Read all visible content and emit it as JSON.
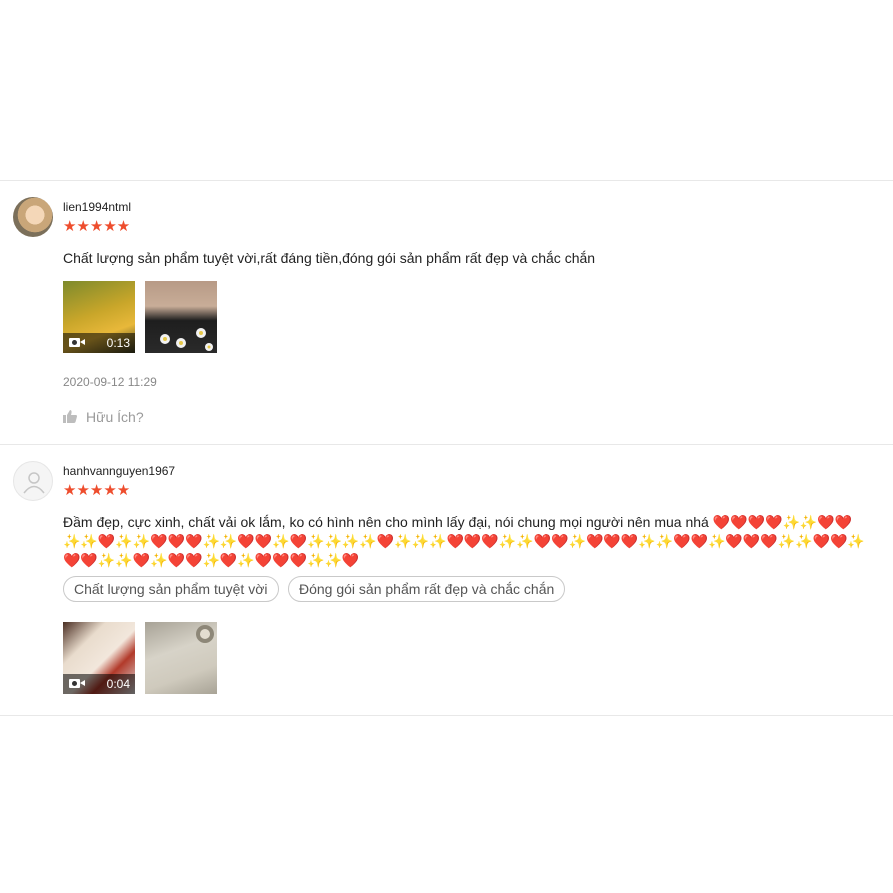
{
  "reviews": [
    {
      "username": "lien1994ntml",
      "stars": "★★★★★",
      "comment": "Chất lượng sản phẩm tuyệt vời,rất đáng tiền,đóng gói sản phẩm rất đẹp và chắc chắn",
      "video_duration": "0:13",
      "date": "2020-09-12 11:29",
      "helpful_label": "Hữu Ích?"
    },
    {
      "username": "hanhvannguyen1967",
      "stars": "★★★★★",
      "comment": "Đầm đẹp, cực xinh, chất vải ok lắm, ko có hình nên cho mình lấy đại, nói chung mọi người nên mua nhá ❤️❤️❤️❤️✨✨❤️❤️✨✨❤️✨✨❤️❤️❤️✨✨❤️❤️✨❤️✨✨✨✨❤️✨✨✨❤️❤️❤️✨✨❤️❤️✨❤️❤️❤️✨✨❤️❤️✨❤️❤️❤️✨✨❤️❤️✨❤️❤️✨✨❤️✨❤️❤️✨❤️✨❤️❤️❤️✨✨❤️",
      "tags": [
        "Chất lượng sản phẩm tuyệt vời",
        "Đóng gói sản phẩm rất đẹp và chắc chắn"
      ],
      "video_duration": "0:04"
    }
  ],
  "colors": {
    "accent": "#ee4d2d",
    "divider": "#e8e8e8",
    "muted": "#888888"
  }
}
